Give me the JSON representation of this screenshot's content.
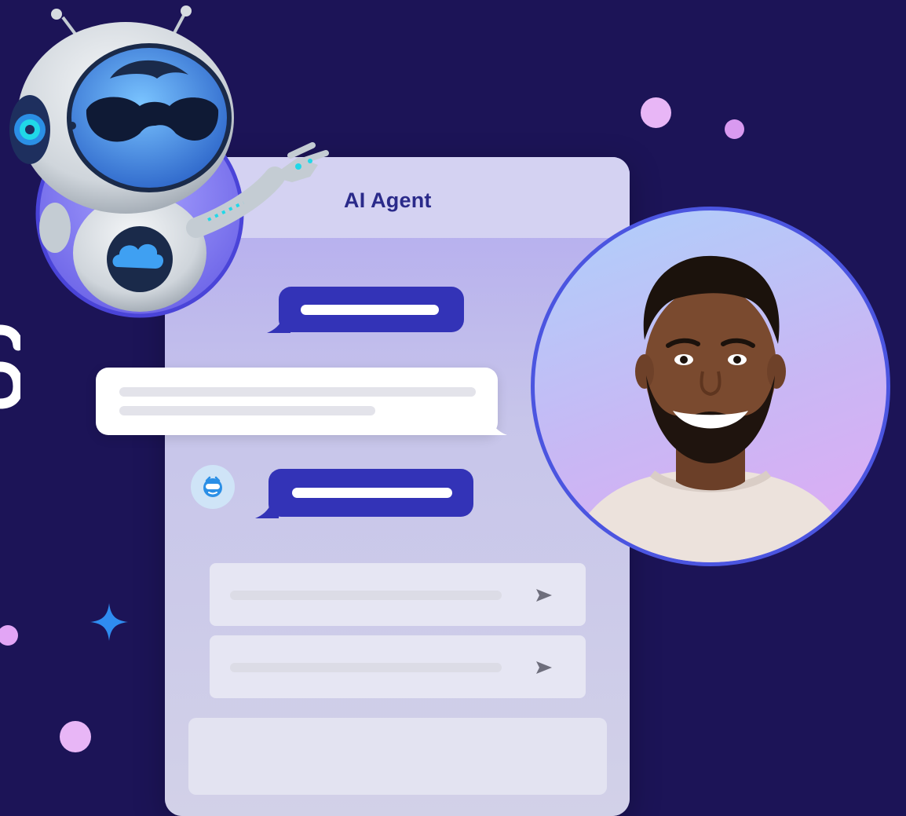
{
  "chat": {
    "title": "AI Agent"
  },
  "icons": {
    "agent": "robot-face-icon",
    "send": "send-arrow-icon",
    "sparkle": "sparkle-icon"
  },
  "colors": {
    "background": "#1c1457",
    "accent_blue": "#3333b7",
    "panel": "#cfcfea",
    "dot_pink": "#e8b6f6",
    "sparkle_blue": "#2f8cf0"
  }
}
